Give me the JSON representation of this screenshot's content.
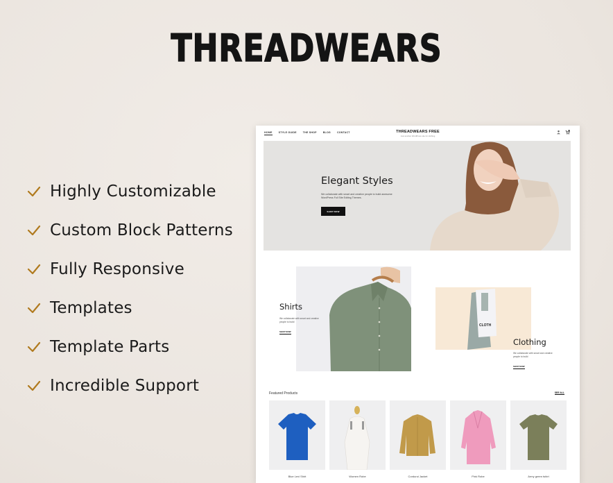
{
  "brand": {
    "title": "THREADWEARS"
  },
  "features": [
    {
      "icon": "check-icon",
      "label": "Highly Customizable"
    },
    {
      "icon": "check-icon",
      "label": "Custom Block Patterns"
    },
    {
      "icon": "check-icon",
      "label": "Fully Responsive"
    },
    {
      "icon": "check-icon",
      "label": "Templates"
    },
    {
      "icon": "check-icon",
      "label": "Template Parts"
    },
    {
      "icon": "check-icon",
      "label": "Incredible Support"
    }
  ],
  "colors": {
    "accent": "#b07a1e",
    "background": "#ede7e2",
    "dark": "#111111"
  },
  "site": {
    "nav": [
      "HOME",
      "STYLE GUIDE",
      "THE SHOP",
      "BLOG",
      "CONTACT"
    ],
    "logo": {
      "name": "THREADWEARS FREE",
      "tagline": "Just another WordPress site for clothing"
    },
    "header_icons": [
      "user-icon",
      "cart-icon"
    ],
    "hero": {
      "title": "Elegant Styles",
      "description": "We collaborate with smart and creative people to build awesome WordPress Full Site Editing Themes.",
      "button": "SHOP NOW"
    },
    "categories": [
      {
        "title": "Shirts",
        "description": "We collaborate with smart and creative people to build",
        "link": "SHOP NOW"
      },
      {
        "title": "Clothing",
        "description": "We collaborate with smart and creative people to build",
        "link": "SHOP NOW",
        "tag_text": "CLOTH"
      }
    ],
    "featured": {
      "title": "Featured Products",
      "see_all": "SEE ALL",
      "products": [
        {
          "name": "Blue Levi Shirt",
          "color": "#1e5fc0"
        },
        {
          "name": "Women Robe",
          "color": "#f4f2ee"
        },
        {
          "name": "Corduroi Jacket",
          "color": "#c19a4a"
        },
        {
          "name": "Pink Robe",
          "color": "#ef9bbd"
        },
        {
          "name": "Army green tshirt",
          "color": "#7b7f5a"
        }
      ]
    }
  }
}
